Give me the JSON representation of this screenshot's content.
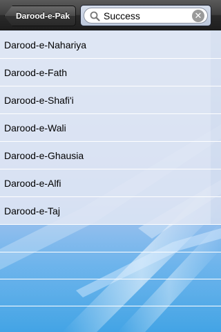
{
  "navbar": {
    "back_label": "Darood-e-Pak"
  },
  "search": {
    "value": "Success",
    "clear_icon": "clear-icon",
    "search_icon": "search-icon"
  },
  "list": {
    "items": [
      "Darood-e-Nahariya",
      "Darood-e-Fath",
      "Darood-e-Shafi'i",
      "Darood-e-Wali",
      "Darood-e-Ghausia",
      "Darood-e-Alfi",
      "Darood-e-Taj"
    ]
  }
}
